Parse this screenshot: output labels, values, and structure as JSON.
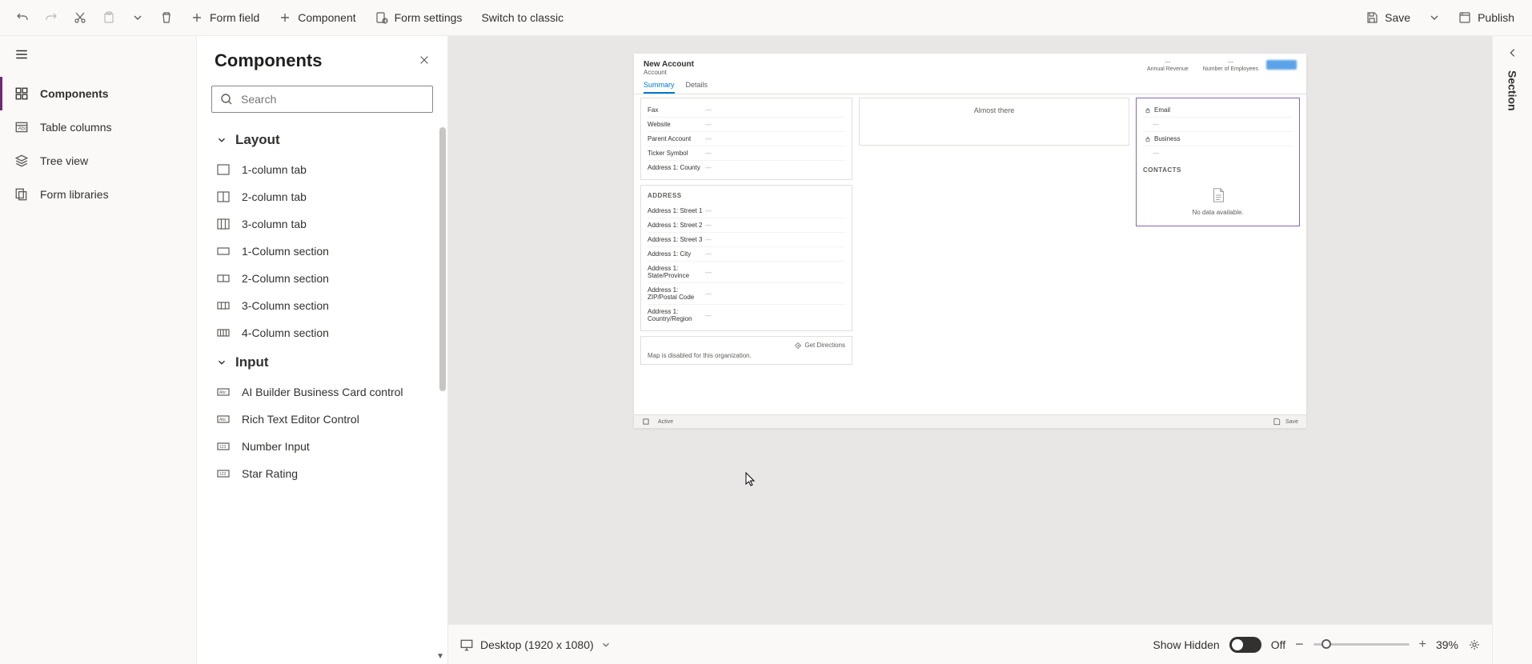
{
  "toolbar": {
    "form_field": "Form field",
    "component": "Component",
    "form_settings": "Form settings",
    "switch_classic": "Switch to classic",
    "save": "Save",
    "publish": "Publish"
  },
  "nav": {
    "components": "Components",
    "table_columns": "Table columns",
    "tree_view": "Tree view",
    "form_libraries": "Form libraries"
  },
  "panel": {
    "title": "Components",
    "search_placeholder": "Search",
    "group_layout": "Layout",
    "group_input": "Input",
    "layout_items": [
      "1-column tab",
      "2-column tab",
      "3-column tab",
      "1-Column section",
      "2-Column section",
      "3-Column section",
      "4-Column section"
    ],
    "input_items": [
      "AI Builder Business Card control",
      "Rich Text Editor Control",
      "Number Input",
      "Star Rating"
    ]
  },
  "form": {
    "title": "New Account",
    "entity": "Account",
    "header_fields": [
      "Annual Revenue",
      "Number of Employees"
    ],
    "tabs": [
      "Summary",
      "Details"
    ],
    "col1_fields_top": [
      "Fax",
      "Website",
      "Parent Account",
      "Ticker Symbol",
      "Address 1: County"
    ],
    "address_section": "ADDRESS",
    "col1_fields_address": [
      "Address 1: Street 1",
      "Address 1: Street 2",
      "Address 1: Street 3",
      "Address 1: City",
      "Address 1: State/Province",
      "Address 1: ZIP/Postal Code",
      "Address 1: Country/Region"
    ],
    "get_directions": "Get Directions",
    "map_disabled": "Map is disabled for this organization.",
    "timeline_header": "Almost there",
    "side_fields": [
      "Email",
      "Business"
    ],
    "contacts_label": "CONTACTS",
    "no_data": "No data available.",
    "dash": "---",
    "footer_status": "Active",
    "footer_save": "Save"
  },
  "bottom": {
    "device": "Desktop (1920 x 1080)",
    "show_hidden": "Show Hidden",
    "toggle_state": "Off",
    "zoom_pct": "39%"
  },
  "right_panel": {
    "label": "Section"
  }
}
